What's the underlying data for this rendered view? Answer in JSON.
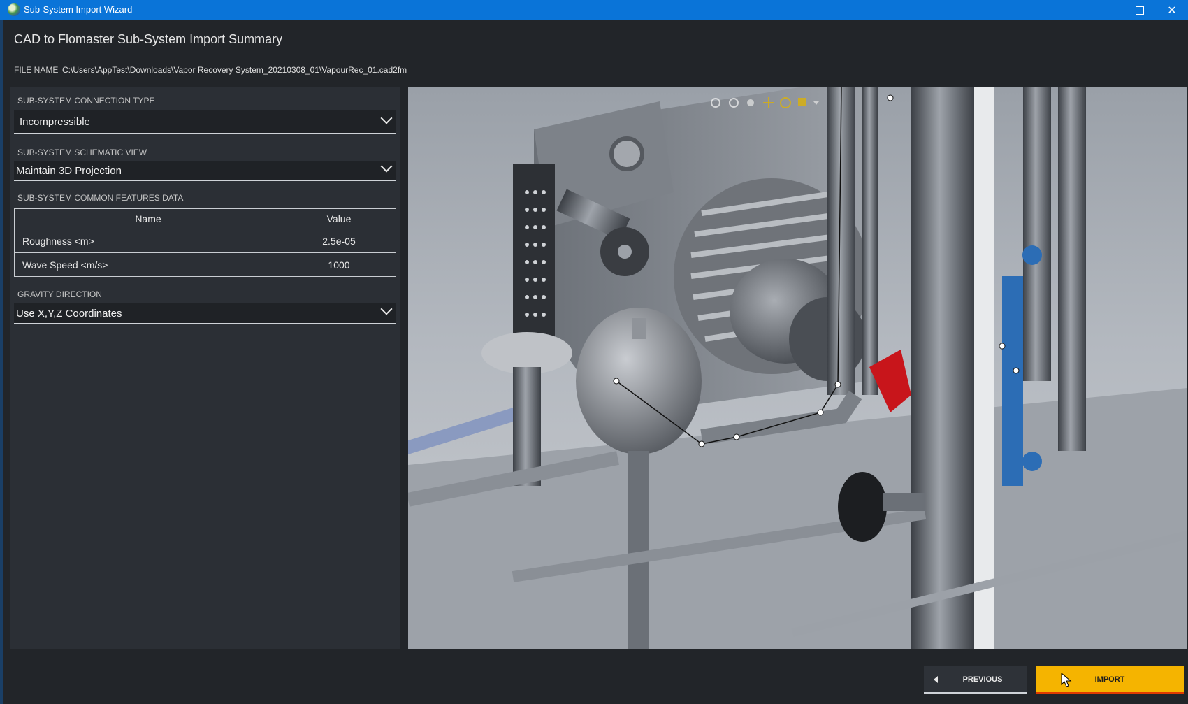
{
  "window": {
    "title": "Sub-System Import Wizard"
  },
  "header": {
    "title": "CAD to Flomaster Sub-System Import Summary",
    "file_label": "FILE NAME",
    "file_path": "C:\\Users\\AppTest\\Downloads\\Vapor Recovery System_20210308_01\\VapourRec_01.cad2fm"
  },
  "connection_type": {
    "label": "SUB-SYSTEM CONNECTION TYPE",
    "value": "Incompressible"
  },
  "schematic_view": {
    "label": "SUB-SYSTEM SCHEMATIC VIEW",
    "value": "Maintain 3D Projection"
  },
  "features": {
    "label": "SUB-SYSTEM COMMON FEATURES DATA",
    "columns": [
      "Name",
      "Value"
    ],
    "rows": [
      {
        "name": "Roughness <m>",
        "value": "2.5e-05"
      },
      {
        "name": "Wave Speed <m/s>",
        "value": "1000"
      }
    ]
  },
  "gravity": {
    "label": "GRAVITY DIRECTION",
    "value": "Use X,Y,Z Coordinates"
  },
  "footer": {
    "previous_label": "PREVIOUS",
    "import_label": "IMPORT"
  },
  "colors": {
    "titlebar": "#0a74d8",
    "import_button": "#f5b400",
    "import_accent": "#e03a00",
    "highlight_valve": "#c8151b",
    "blue_valves": "#2c6db5"
  }
}
